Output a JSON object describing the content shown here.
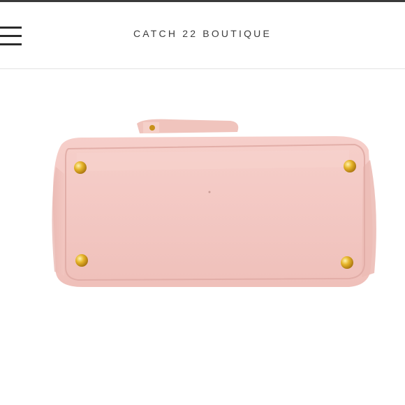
{
  "header": {
    "brand_name": "CATCH 22 BOUTIQUE",
    "menu_icon": "hamburger-menu-icon"
  },
  "product_image": {
    "subject": "pink saffiano leather handbag bottom view",
    "colors": {
      "leather": "#f3c9c4",
      "feet": "#d8a21c"
    }
  }
}
